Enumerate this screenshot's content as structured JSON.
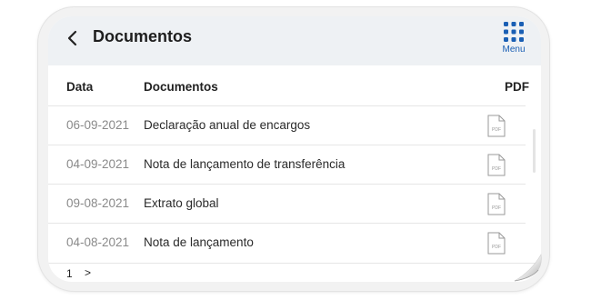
{
  "header": {
    "title": "Documentos",
    "menu_label": "Menu",
    "back_icon": "chevron-left-icon",
    "menu_icon": "grid-icon"
  },
  "table": {
    "columns": [
      "Data",
      "Documentos",
      "PDF"
    ],
    "rows": [
      {
        "date": "06-09-2021",
        "document": "Declaração anual de encargos",
        "pdf_icon": "pdf-file-icon"
      },
      {
        "date": "04-09-2021",
        "document": "Nota de lançamento de transferência",
        "pdf_icon": "pdf-file-icon"
      },
      {
        "date": "09-08-2021",
        "document": "Extrato global",
        "pdf_icon": "pdf-file-icon"
      },
      {
        "date": "04-08-2021",
        "document": "Nota de lançamento",
        "pdf_icon": "pdf-file-icon"
      }
    ]
  },
  "pagination": {
    "current": "1",
    "next": ">"
  },
  "colors": {
    "accent": "#1a5fb4",
    "header_bg": "#eef1f4",
    "date_text": "#8a8a8a"
  }
}
